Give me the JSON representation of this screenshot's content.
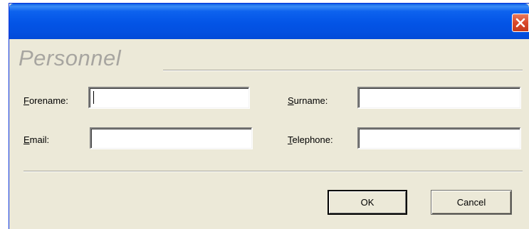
{
  "window": {
    "title": "",
    "close_glyph": "close-icon"
  },
  "section": {
    "title": "Personnel"
  },
  "fields": {
    "forename": {
      "label_mnemonic": "F",
      "label_rest": "orename:",
      "value": ""
    },
    "surname": {
      "label_mnemonic": "S",
      "label_rest": "urname:",
      "value": ""
    },
    "email": {
      "label_mnemonic": "E",
      "label_rest": "mail:",
      "value": ""
    },
    "telephone": {
      "label_mnemonic": "T",
      "label_rest": "elephone:",
      "value": ""
    }
  },
  "buttons": {
    "ok": "OK",
    "cancel": "Cancel"
  },
  "colors": {
    "titlebar": "#0354e6",
    "dialog_bg": "#ece9d8",
    "close_button": "#d9482a",
    "section_title": "#a7a5a0"
  }
}
